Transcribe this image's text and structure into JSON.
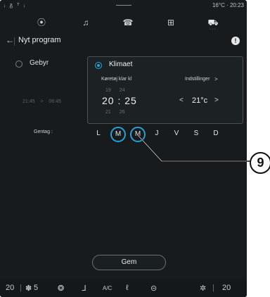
{
  "statusbar": {
    "signal_icons": "ᵢ ᵹ ᵀ ᵢ",
    "temperature": "16°C",
    "time": "20:23"
  },
  "topnav": {
    "items": [
      {
        "icon": "location-icon",
        "glyph": "⦿"
      },
      {
        "icon": "music-icon",
        "glyph": "♫"
      },
      {
        "icon": "phone-icon",
        "glyph": "☎"
      },
      {
        "icon": "apps-grid-icon",
        "glyph": "⊞"
      },
      {
        "icon": "car-icon",
        "glyph": "⛟"
      }
    ],
    "active_dots": "···"
  },
  "titlebar": {
    "back_glyph": "←",
    "title": "Nyt program",
    "info_glyph": "!"
  },
  "gebyr": {
    "label": "Gebyr",
    "times": "21:45 > 06:45"
  },
  "klimaet": {
    "label": "Klimaet",
    "ready_label": "Køretøj klar kl",
    "settings_label": "Indstillinger",
    "settings_chevron": ">",
    "time_prev": "19 24",
    "time_current": "20 : 25",
    "time_next": "21 26",
    "temp_left": "<",
    "temp_value": "21°c",
    "temp_right": ">"
  },
  "repeat": {
    "label": "Gentag :",
    "days": [
      {
        "label": "L",
        "selected": false
      },
      {
        "label": "M",
        "selected": true
      },
      {
        "label": "M",
        "selected": true
      },
      {
        "label": "J",
        "selected": false
      },
      {
        "label": "V",
        "selected": false
      },
      {
        "label": "S",
        "selected": false
      },
      {
        "label": "D",
        "selected": false
      }
    ]
  },
  "save_button": {
    "label": "Gem"
  },
  "bottombar": {
    "left_temp": "20",
    "fan": "5",
    "ac_label": "A/C",
    "right_temp": "20"
  },
  "callout": {
    "number": "9"
  },
  "colors": {
    "background": "#171b1e",
    "accent": "#2c9fd1"
  }
}
